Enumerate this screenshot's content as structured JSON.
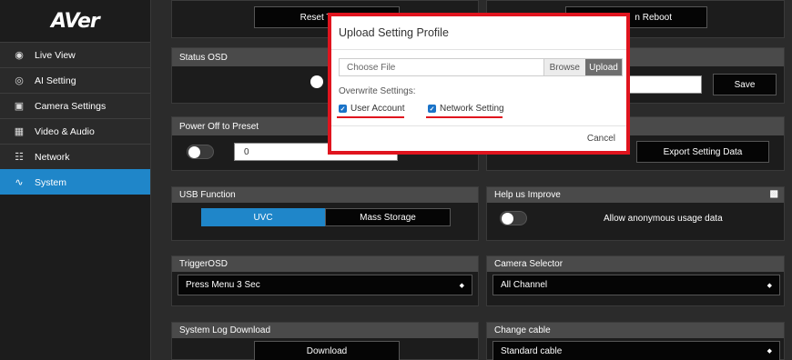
{
  "brand": {
    "logo": "AVer"
  },
  "sidebar": {
    "items": [
      {
        "label": "Live View",
        "icon": "eye-icon",
        "active": false
      },
      {
        "label": "AI Setting",
        "icon": "ai-target-icon",
        "active": false
      },
      {
        "label": "Camera Settings",
        "icon": "image-icon",
        "active": false
      },
      {
        "label": "Video & Audio",
        "icon": "video-audio-icon",
        "active": false
      },
      {
        "label": "Network",
        "icon": "network-icon",
        "active": false
      },
      {
        "label": "System",
        "icon": "pulse-icon",
        "active": true
      }
    ]
  },
  "top_buttons": {
    "reset": "Reset To Fac",
    "reboot": "n Reboot"
  },
  "status_osd": {
    "header": "Status OSD"
  },
  "power_off": {
    "header": "Power Off to Preset",
    "value": "0"
  },
  "right_save": {
    "save_label": "Save"
  },
  "export": {
    "label": "Export Setting Data"
  },
  "usb": {
    "header": "USB Function",
    "uvc": "UVC",
    "mass": "Mass Storage"
  },
  "help": {
    "header": "Help us Improve",
    "label": "Allow anonymous usage data"
  },
  "trigger": {
    "header": "TriggerOSD",
    "value": "Press Menu 3 Sec"
  },
  "camera_selector": {
    "header": "Camera Selector",
    "value": "All Channel"
  },
  "syslog": {
    "header": "System Log Download",
    "button": "Download"
  },
  "change_cable": {
    "header": "Change cable",
    "value": "Standard cable"
  },
  "modal": {
    "title": "Upload Setting Profile",
    "file_placeholder": "Choose File",
    "browse": "Browse",
    "upload": "Upload",
    "overwrite_label": "Overwrite Settings:",
    "user_account": "User Account",
    "network_setting": "Network Setting",
    "cancel": "Cancel"
  },
  "colors": {
    "accent": "#1f86c9",
    "highlight": "#e0141e"
  }
}
